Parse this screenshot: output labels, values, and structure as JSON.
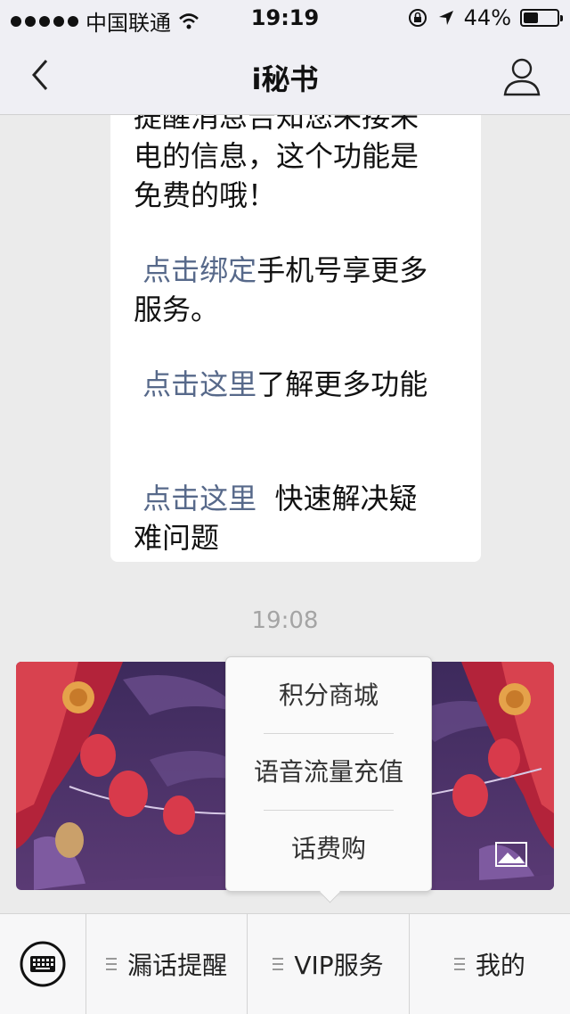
{
  "status_bar": {
    "carrier": "中国联通",
    "time": "19:19",
    "battery": "44%",
    "battery_level": 0.44,
    "signal_icon": "signal-dots-icon",
    "wifi_icon": "wifi-icon",
    "rotation_lock_icon": "rotation-lock-icon",
    "location_icon": "location-arrow-icon"
  },
  "nav": {
    "title": "i秘书",
    "back_icon": "chevron-left-icon",
    "profile_icon": "person-icon"
  },
  "message": {
    "top_partial": "提醒消息告知您来接来",
    "line2": "电的信息，这个功能是",
    "line3": "免费的哦！",
    "bind_link": "点击绑定",
    "bind_text1": "手机号享更多",
    "bind_text2": "服务。",
    "more_link": "点击这里",
    "more_text": "了解更多功能",
    "faq_link": "点击这里",
    "faq_text1": "快速解决疑",
    "faq_text2": "难问题"
  },
  "timestamp": "19:08",
  "popup_menu": {
    "items": [
      {
        "label": "积分商城"
      },
      {
        "label": "语音流量充值"
      },
      {
        "label": "话费购"
      }
    ]
  },
  "tab_bar": {
    "keyboard_icon": "keyboard-icon",
    "tabs": [
      {
        "label": "漏话提醒"
      },
      {
        "label": "VIP服务"
      },
      {
        "label": "我的"
      }
    ]
  },
  "colors": {
    "link": "#57698a",
    "background": "#ebebeb",
    "bar": "#efeff4"
  }
}
